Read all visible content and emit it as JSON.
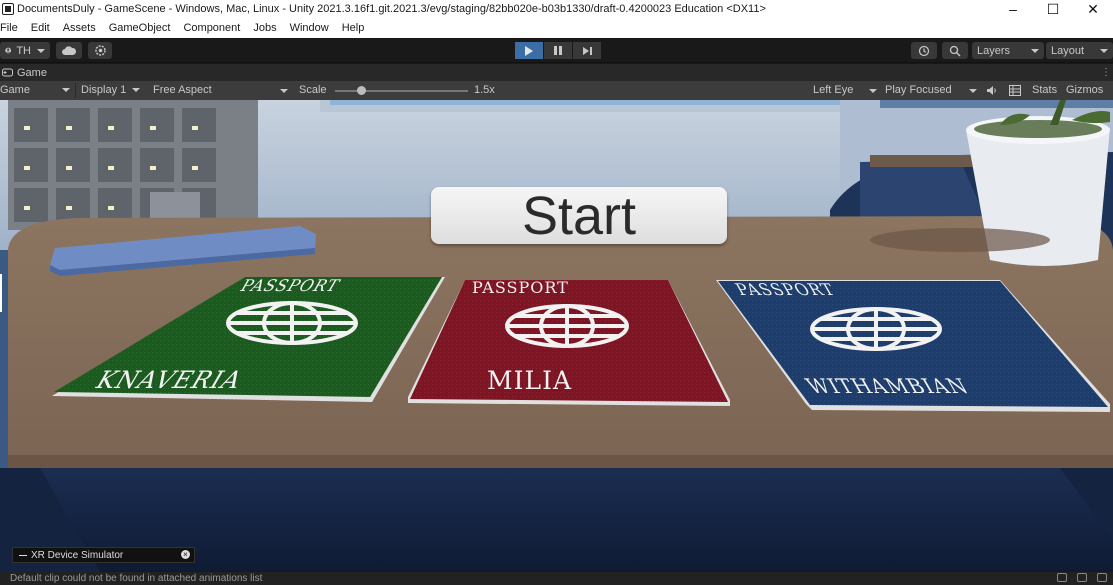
{
  "window": {
    "title": "DocumentsDuly - GameScene - Windows, Mac, Linux - Unity 2021.3.16f1.git.2021.3/evg/staging/82bb020e-b03b1330/draft-0.4200023 Education <DX11>",
    "minimize": "‒",
    "maximize": "☐",
    "close": "✕"
  },
  "menu": [
    "File",
    "Edit",
    "Assets",
    "GameObject",
    "Component",
    "Jobs",
    "Window",
    "Help"
  ],
  "toolbar": {
    "account": "TH",
    "layers": "Layers",
    "layout": "Layout"
  },
  "tab": {
    "label": "Game"
  },
  "game_toolbar": {
    "view_mode": "Game",
    "display": "Display 1",
    "aspect": "Free Aspect",
    "scale_label": "Scale",
    "scale_value": "1.5x",
    "eye": "Left Eye",
    "play_mode": "Play Focused",
    "stats": "Stats",
    "gizmos": "Gizmos"
  },
  "scene": {
    "start_button": "Start",
    "passports": [
      {
        "header": "PASSPORT",
        "country": "KNAVERIA",
        "color": "#1d5a21"
      },
      {
        "header": "PASSPORT",
        "country": "MILIA",
        "color": "#7c1624"
      },
      {
        "header": "PASSPORT",
        "country": "WITHAMBIAN",
        "color": "#1f3d6b"
      }
    ]
  },
  "xr_simulator": {
    "label": "XR Device Simulator"
  },
  "status": {
    "message": "Default clip could not be found in attached animations list"
  }
}
